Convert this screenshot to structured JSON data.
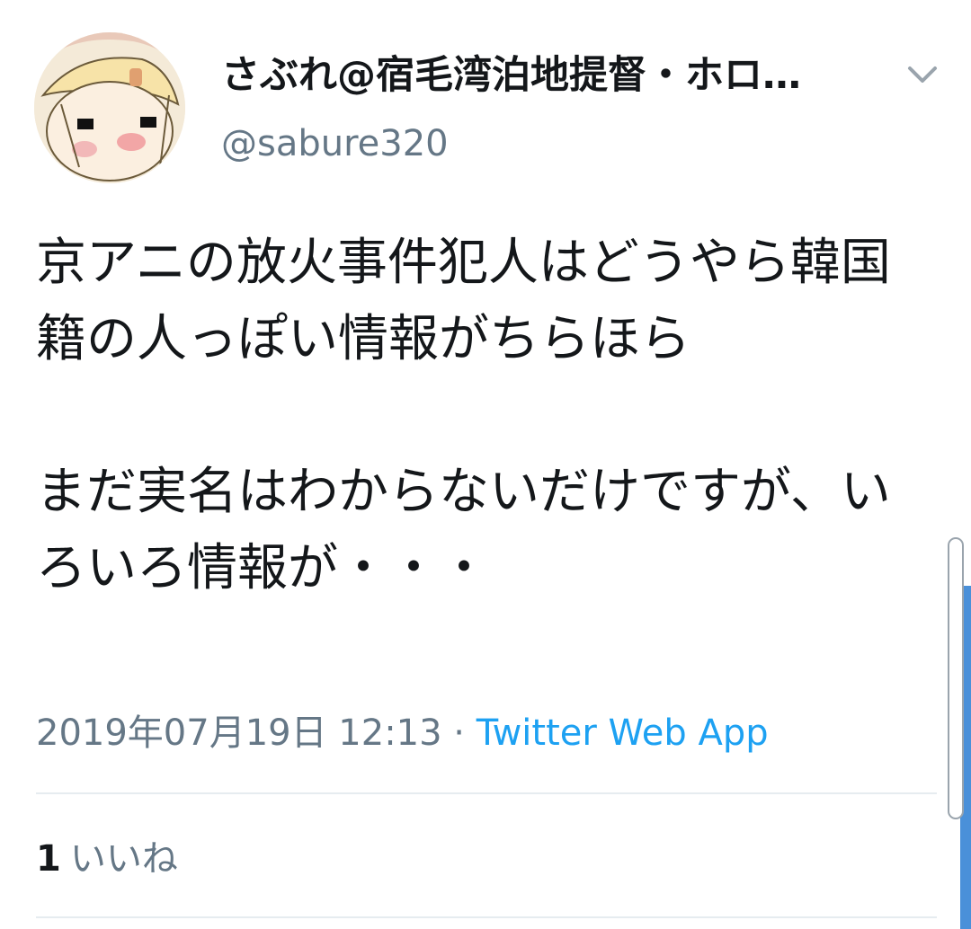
{
  "tweet": {
    "display_name": "さぶれ@宿毛湾泊地提督・ホロ…",
    "handle": "@sabure320",
    "text": "京アニの放火事件犯人はどうやら韓国籍の人っぽい情報がちらほら\n\nまだ実名はわからないだけですが、いろいろ情報が・・・",
    "timestamp": "2019年07月19日 12:13",
    "separator": " · ",
    "source": "Twitter Web App",
    "like_count": "1",
    "like_label": "いいね"
  },
  "icons": {
    "avatar": "avatar-anime-illustration",
    "menu": "chevron-down-icon"
  },
  "colors": {
    "text": "#14171a",
    "secondary": "#657786",
    "link": "#1da1f2",
    "divider": "#e6ecf0"
  }
}
